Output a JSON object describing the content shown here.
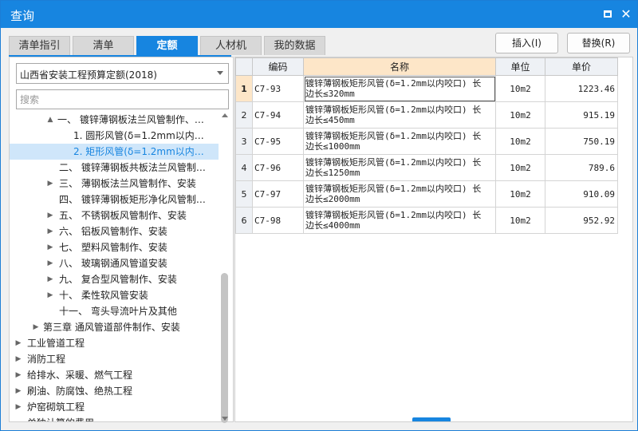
{
  "window": {
    "title": "查询"
  },
  "tabs": [
    {
      "label": "清单指引",
      "active": false
    },
    {
      "label": "清单",
      "active": false
    },
    {
      "label": "定额",
      "active": true
    },
    {
      "label": "人材机",
      "active": false
    },
    {
      "label": "我的数据",
      "active": false
    }
  ],
  "actions": {
    "insert": "插入(I)",
    "replace": "替换(R)"
  },
  "library": {
    "selected": "山西省安装工程预算定额(2018)"
  },
  "search": {
    "placeholder": "搜索"
  },
  "tree": [
    {
      "expander": "▲",
      "text": "一、 镀锌薄钢板法兰风管制作、…",
      "selected": false
    },
    {
      "expander": "",
      "text": "1. 圆形风管(δ=1.2mm以内…",
      "selected": false
    },
    {
      "expander": "",
      "text": "2. 矩形风管(δ=1.2mm以内…",
      "selected": true
    },
    {
      "expander": "",
      "text": "二、 镀锌薄钢板共板法兰风管制…",
      "selected": false
    },
    {
      "expander": "▶",
      "text": "三、 薄钢板法兰风管制作、安装",
      "selected": false
    },
    {
      "expander": "",
      "text": "四、 镀锌薄钢板矩形净化风管制…",
      "selected": false
    },
    {
      "expander": "▶",
      "text": "五、 不锈钢板风管制作、安装",
      "selected": false
    },
    {
      "expander": "▶",
      "text": "六、 铝板风管制作、安装",
      "selected": false
    },
    {
      "expander": "▶",
      "text": "七、 塑料风管制作、安装",
      "selected": false
    },
    {
      "expander": "▶",
      "text": "八、 玻璃钢通风管道安装",
      "selected": false
    },
    {
      "expander": "▶",
      "text": "九、 复合型风管制作、安装",
      "selected": false
    },
    {
      "expander": "▶",
      "text": "十、 柔性软风管安装",
      "selected": false
    },
    {
      "expander": "",
      "text": "十一、 弯头导流叶片及其他",
      "selected": false
    },
    {
      "expander": "▶",
      "text": "第三章 通风管道部件制作、安装",
      "selected": false
    },
    {
      "expander": "▶",
      "text": "工业管道工程",
      "selected": false
    },
    {
      "expander": "▶",
      "text": "消防工程",
      "selected": false
    },
    {
      "expander": "▶",
      "text": "给排水、采暖、燃气工程",
      "selected": false
    },
    {
      "expander": "▶",
      "text": "刷油、防腐蚀、绝热工程",
      "selected": false
    },
    {
      "expander": "▶",
      "text": "炉窑砌筑工程",
      "selected": false
    },
    {
      "expander": "",
      "text": "单独计算的费用",
      "selected": false
    }
  ],
  "table": {
    "headers": {
      "code": "编码",
      "name": "名称",
      "unit": "单位",
      "price": "单价"
    },
    "rows": [
      {
        "idx": "1",
        "code": "C7-93",
        "name1": "镀锌薄钢板矩形风管(δ=1.2mm以内咬口) 长",
        "name2": "边长≤320mm",
        "unit": "10m2",
        "price": "1223.46"
      },
      {
        "idx": "2",
        "code": "C7-94",
        "name1": "镀锌薄钢板矩形风管(δ=1.2mm以内咬口) 长",
        "name2": "边长≤450mm",
        "unit": "10m2",
        "price": "915.19"
      },
      {
        "idx": "3",
        "code": "C7-95",
        "name1": "镀锌薄钢板矩形风管(δ=1.2mm以内咬口) 长",
        "name2": "边长≤1000mm",
        "unit": "10m2",
        "price": "750.19"
      },
      {
        "idx": "4",
        "code": "C7-96",
        "name1": "镀锌薄钢板矩形风管(δ=1.2mm以内咬口) 长",
        "name2": "边长≤1250mm",
        "unit": "10m2",
        "price": "789.6"
      },
      {
        "idx": "5",
        "code": "C7-97",
        "name1": "镀锌薄钢板矩形风管(δ=1.2mm以内咬口) 长",
        "name2": "边长≤2000mm",
        "unit": "10m2",
        "price": "910.09"
      },
      {
        "idx": "6",
        "code": "C7-98",
        "name1": "镀锌薄钢板矩形风管(δ=1.2mm以内咬口) 长",
        "name2": "边长≤4000mm",
        "unit": "10m2",
        "price": "952.92"
      }
    ]
  },
  "colors": {
    "accent": "#1785e0",
    "selected_row": "#cfe6fa",
    "header_highlight": "#fde6c8"
  }
}
